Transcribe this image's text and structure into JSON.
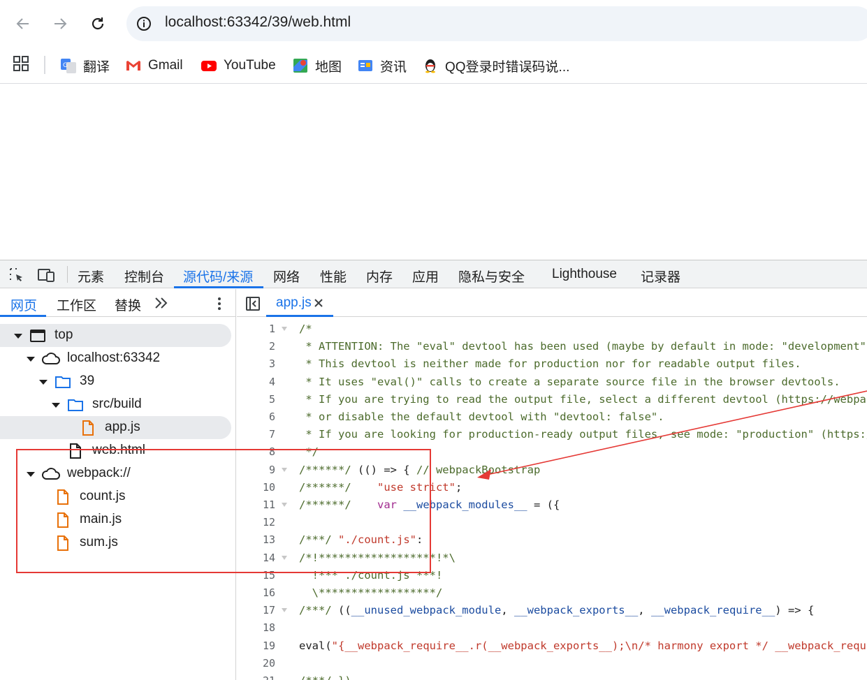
{
  "browser": {
    "url": "localhost:63342/39/web.html",
    "bookmarks": [
      {
        "label": "翻译",
        "icon": "google-translate-icon"
      },
      {
        "label": "Gmail",
        "icon": "gmail-icon"
      },
      {
        "label": "YouTube",
        "icon": "youtube-icon"
      },
      {
        "label": "地图",
        "icon": "google-maps-icon"
      },
      {
        "label": "资讯",
        "icon": "google-news-icon"
      },
      {
        "label": "QQ登录时错误码说...",
        "icon": "qq-penguin-icon"
      }
    ]
  },
  "devtools": {
    "tabs": [
      "元素",
      "控制台",
      "源代码/来源",
      "网络",
      "性能",
      "内存",
      "应用",
      "隐私与安全",
      "Lighthouse",
      "记录器"
    ],
    "active_tab": "源代码/来源",
    "navigator_tabs": [
      "网页",
      "工作区",
      "替换"
    ],
    "active_navigator_tab": "网页",
    "tree": [
      {
        "label": "top",
        "type": "frame",
        "expanded": true
      },
      {
        "label": "localhost:63342",
        "type": "origin",
        "expanded": true
      },
      {
        "label": "39",
        "type": "folder",
        "expanded": true
      },
      {
        "label": "src/build",
        "type": "folder",
        "expanded": true
      },
      {
        "label": "app.js",
        "type": "file-js",
        "selected": true
      },
      {
        "label": "web.html",
        "type": "file"
      },
      {
        "label": "webpack://",
        "type": "origin",
        "expanded": true
      },
      {
        "label": "count.js",
        "type": "file-js"
      },
      {
        "label": "main.js",
        "type": "file-js"
      },
      {
        "label": "sum.js",
        "type": "file-js"
      }
    ],
    "open_file": "app.js",
    "code_lines": [
      {
        "n": "1",
        "fold": true,
        "parts": [
          [
            "/*",
            "com"
          ]
        ]
      },
      {
        "n": "2",
        "fold": false,
        "parts": [
          [
            " * ATTENTION: The \"eval\" devtool has been used (maybe by default in mode: \"development\").",
            "com"
          ]
        ]
      },
      {
        "n": "3",
        "fold": false,
        "parts": [
          [
            " * This devtool is neither made for production nor for readable output files.",
            "com"
          ]
        ]
      },
      {
        "n": "4",
        "fold": false,
        "parts": [
          [
            " * It uses \"eval()\" calls to create a separate source file in the browser devtools.",
            "com"
          ]
        ]
      },
      {
        "n": "5",
        "fold": false,
        "parts": [
          [
            " * If you are trying to read the output file, select a different devtool (https://webpack.j",
            "com"
          ]
        ]
      },
      {
        "n": "6",
        "fold": false,
        "parts": [
          [
            " * or disable the default devtool with \"devtool: false\".",
            "com"
          ]
        ]
      },
      {
        "n": "7",
        "fold": false,
        "parts": [
          [
            " * If you are looking for production-ready output files, see mode: \"production\" (https://we",
            "com"
          ]
        ]
      },
      {
        "n": "8",
        "fold": false,
        "parts": [
          [
            " */",
            "com"
          ]
        ]
      },
      {
        "n": "9",
        "fold": true,
        "parts": [
          [
            "/******/",
            "com"
          ],
          [
            " (() => { ",
            "plain"
          ],
          [
            "// webpackBootstrap",
            "com"
          ]
        ]
      },
      {
        "n": "10",
        "fold": false,
        "parts": [
          [
            "/******/",
            "com"
          ],
          [
            "    ",
            "plain"
          ],
          [
            "\"use strict\"",
            "str"
          ],
          [
            ";",
            "plain"
          ]
        ]
      },
      {
        "n": "11",
        "fold": true,
        "parts": [
          [
            "/******/",
            "com"
          ],
          [
            "    ",
            "plain"
          ],
          [
            "var",
            "key"
          ],
          [
            " ",
            "plain"
          ],
          [
            "__webpack_modules__",
            "def"
          ],
          [
            " = ({",
            "plain"
          ]
        ]
      },
      {
        "n": "12",
        "fold": false,
        "parts": [
          [
            "",
            "plain"
          ]
        ]
      },
      {
        "n": "13",
        "fold": false,
        "parts": [
          [
            "/***/",
            "com"
          ],
          [
            " ",
            "plain"
          ],
          [
            "\"./count.js\"",
            "str"
          ],
          [
            ":",
            "plain"
          ]
        ]
      },
      {
        "n": "14",
        "fold": true,
        "parts": [
          [
            "/*!******************!*\\",
            "com"
          ]
        ]
      },
      {
        "n": "15",
        "fold": false,
        "parts": [
          [
            "  !*** ./count.js ***!",
            "com"
          ]
        ]
      },
      {
        "n": "16",
        "fold": false,
        "parts": [
          [
            "  \\******************/",
            "com"
          ]
        ]
      },
      {
        "n": "17",
        "fold": true,
        "parts": [
          [
            "/***/",
            "com"
          ],
          [
            " ((",
            "plain"
          ],
          [
            "__unused_webpack_module",
            "def"
          ],
          [
            ", ",
            "plain"
          ],
          [
            "__webpack_exports__",
            "def"
          ],
          [
            ", ",
            "plain"
          ],
          [
            "__webpack_require__",
            "def"
          ],
          [
            ") => {",
            "plain"
          ]
        ]
      },
      {
        "n": "18",
        "fold": false,
        "parts": [
          [
            "",
            "plain"
          ]
        ]
      },
      {
        "n": "19",
        "fold": false,
        "parts": [
          [
            "eval(",
            "plain"
          ],
          [
            "\"{__webpack_require__.r(__webpack_exports__);\\n/* harmony export */ __webpack_require__",
            "str"
          ]
        ]
      },
      {
        "n": "20",
        "fold": false,
        "parts": [
          [
            "",
            "plain"
          ]
        ]
      },
      {
        "n": "21",
        "fold": false,
        "parts": [
          [
            "/***/ })",
            "com"
          ]
        ]
      }
    ]
  },
  "colors": {
    "accent": "#1a73e8",
    "annotation": "#e53935",
    "file_js": "#e8710a",
    "folder": "#1a73e8"
  }
}
